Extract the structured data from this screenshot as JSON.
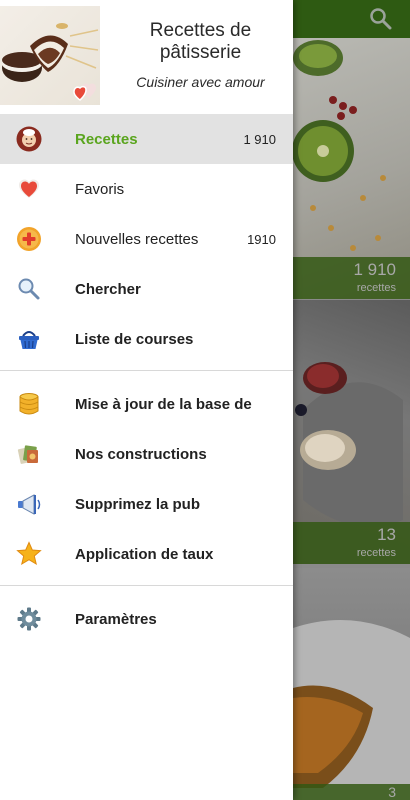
{
  "header": {
    "title": "Recettes de pâtisserie",
    "subtitle": "Cuisiner avec amour"
  },
  "menu": {
    "items": [
      {
        "label": "Recettes",
        "count": "1 910",
        "icon": "chef-icon",
        "active": true
      },
      {
        "label": "Favoris",
        "icon": "heart-icon"
      },
      {
        "label": "Nouvelles recettes",
        "count": "1910",
        "icon": "plus-circle-icon"
      },
      {
        "label": "Chercher",
        "icon": "search-icon"
      },
      {
        "label": "Liste de courses",
        "icon": "shopping-basket-icon"
      }
    ],
    "items2": [
      {
        "label": "Mise à jour de la base de",
        "icon": "database-icon"
      },
      {
        "label": "Nos constructions",
        "icon": "apps-icon"
      },
      {
        "label": "Supprimez la pub",
        "icon": "megaphone-icon"
      },
      {
        "label": "Application de taux",
        "icon": "star-icon"
      }
    ],
    "items3": [
      {
        "label": "Paramètres",
        "icon": "gear-icon"
      }
    ]
  },
  "background": {
    "cards": [
      {
        "count": "1 910",
        "label": "recettes"
      },
      {
        "count": "13",
        "label": "recettes"
      },
      {
        "count": "3"
      }
    ]
  },
  "colors": {
    "accent": "#5aa51e",
    "toolbar": "#4caf1a",
    "active_bg": "#e2e2e2"
  }
}
